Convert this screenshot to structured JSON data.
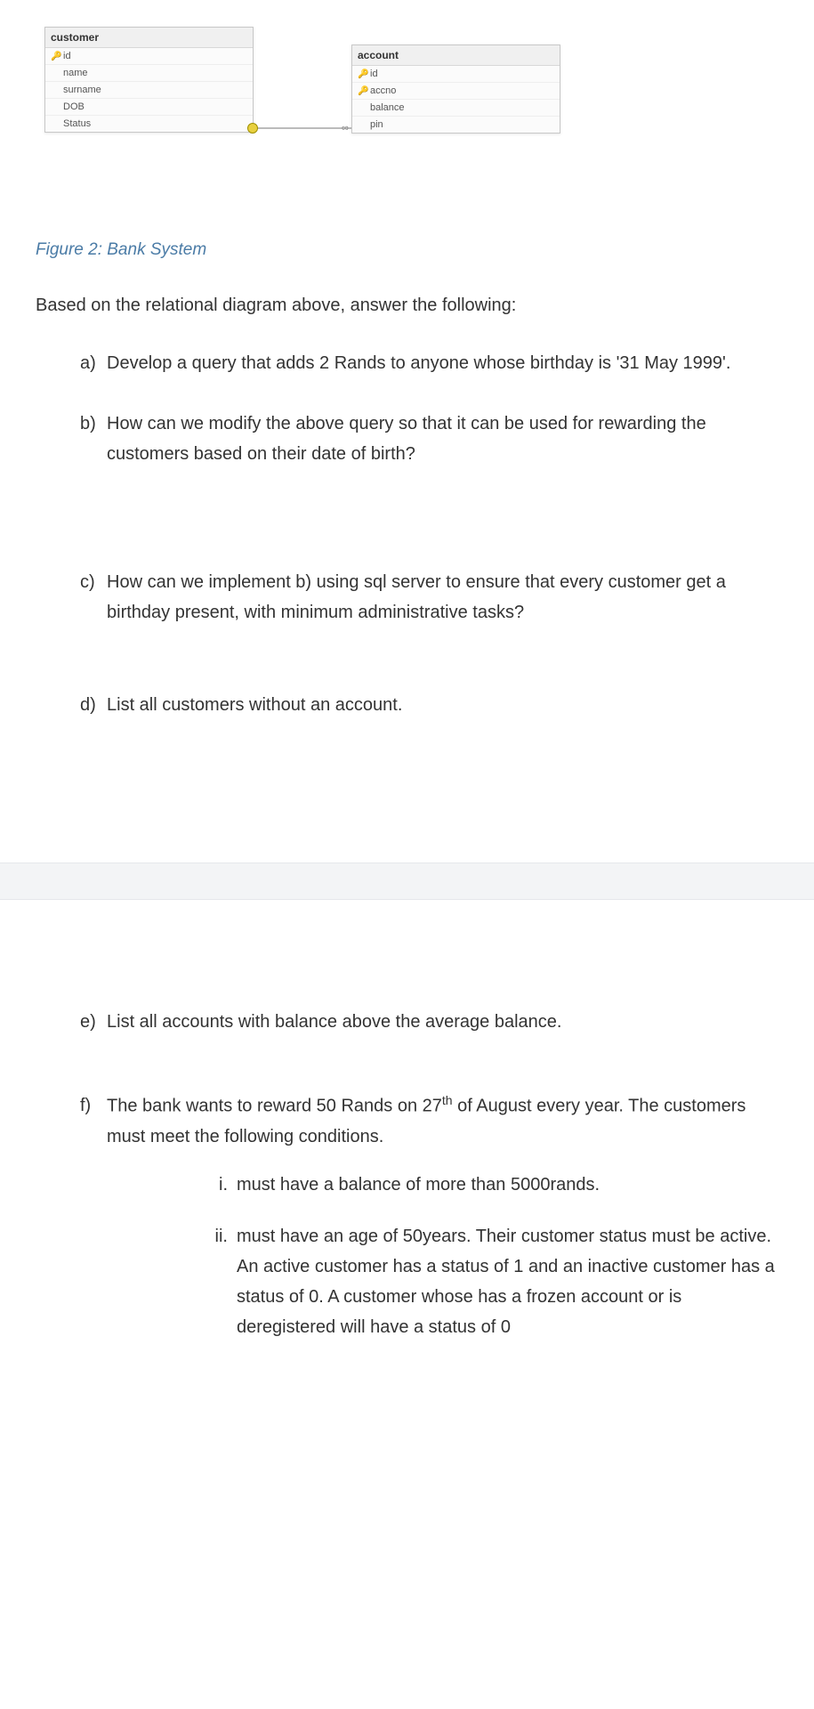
{
  "diagram": {
    "customer": {
      "title": "customer",
      "fields": [
        {
          "key": true,
          "name": "id"
        },
        {
          "key": false,
          "name": "name"
        },
        {
          "key": false,
          "name": "surname"
        },
        {
          "key": false,
          "name": "DOB"
        },
        {
          "key": false,
          "name": "Status"
        }
      ]
    },
    "account": {
      "title": "account",
      "fields": [
        {
          "key": true,
          "name": "id"
        },
        {
          "key": true,
          "name": "accno"
        },
        {
          "key": false,
          "name": "balance"
        },
        {
          "key": false,
          "name": "pin"
        }
      ]
    }
  },
  "figure_caption": "Figure 2: Bank System",
  "intro": "Based on the relational diagram above, answer the following:",
  "questions": {
    "a": {
      "label": "a)",
      "text": "Develop a query that adds 2 Rands to anyone whose birthday is '31 May 1999'."
    },
    "b": {
      "label": "b)",
      "text": "How can we modify the above query so that it can be used for rewarding the customers based on their date of birth?"
    },
    "c": {
      "label": "c)",
      "text": "How can we implement b) using sql server to ensure that every customer get a birthday present, with minimum administrative tasks?"
    },
    "d": {
      "label": "d)",
      "text": "List all customers without an account."
    },
    "e": {
      "label": "e)",
      "text": "List all accounts with balance above the average balance."
    },
    "f": {
      "label": "f)",
      "text_pre": "The bank wants to reward 50 Rands on 27",
      "text_sup": "th",
      "text_post": " of August every year. The customers must meet the following conditions.",
      "subs": {
        "i": {
          "label": "i.",
          "text": "must have a balance of more than 5000rands."
        },
        "ii": {
          "label": "ii.",
          "text": "must have an age of 50years. Their customer status must be active. An active customer has a status of 1 and an inactive customer has a status of 0.  A customer whose has a frozen account or is deregistered will have a status of 0"
        }
      }
    }
  },
  "icons": {
    "key_glyph": "🔑",
    "infinity": "∞"
  }
}
